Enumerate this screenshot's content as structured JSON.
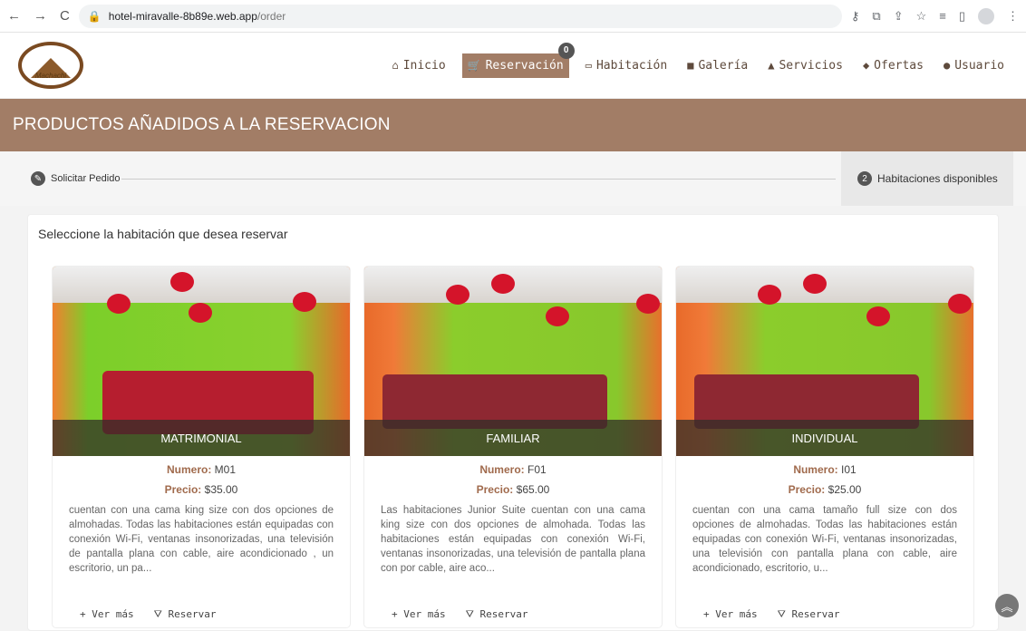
{
  "browser": {
    "url_host": "hotel-miravalle-8b89e.web.app",
    "url_path": "/order"
  },
  "logo": {
    "text": "Machachi"
  },
  "nav": {
    "items": [
      {
        "label": "Inicio",
        "icon": "home-icon"
      },
      {
        "label": "Reservación",
        "icon": "cart-icon",
        "badge": "0"
      },
      {
        "label": "Habitación",
        "icon": "bed-icon"
      },
      {
        "label": "Galería",
        "icon": "image-icon"
      },
      {
        "label": "Servicios",
        "icon": "eject-icon"
      },
      {
        "label": "Ofertas",
        "icon": "tag-icon"
      },
      {
        "label": "Usuario",
        "icon": "user-icon"
      }
    ]
  },
  "banner": {
    "title": "PRODUCTOS AÑADIDOS A LA RESERVACION"
  },
  "stepper": {
    "step1": "Solicitar Pedido",
    "step2_number": "2",
    "step2": "Habitaciones disponibles"
  },
  "main": {
    "heading": "Seleccione la habitación que desea reservar"
  },
  "rooms": [
    {
      "name": "MATRIMONIAL",
      "numero_label": "Numero:",
      "numero": "M01",
      "precio_label": "Precio:",
      "precio": "$35.00",
      "desc": "cuentan con una cama king size con dos opciones de almohadas. Todas las habitaciones están equipadas con conexión Wi-Fi, ventanas insonorizadas, una televisión de pantalla plana con cable, aire acondicionado , un escritorio, un pa..."
    },
    {
      "name": "FAMILIAR",
      "numero_label": "Numero:",
      "numero": "F01",
      "precio_label": "Precio:",
      "precio": "$65.00",
      "desc": "Las habitaciones Junior Suite cuentan con una cama king size con dos opciones de almohada. Todas las habitaciones están equipadas con conexión Wi-Fi, ventanas insonorizadas, una televisión de pantalla plana con por cable, aire aco..."
    },
    {
      "name": "INDIVIDUAL",
      "numero_label": "Numero:",
      "numero": "I01",
      "precio_label": "Precio:",
      "precio": "$25.00",
      "desc": "cuentan con una cama tamaño full size con dos opciones de almohadas. Todas las habitaciones están equipadas con conexión Wi-Fi, ventanas insonorizadas, una televisión con pantalla plana con cable, aire acondicionado, escritorio, u..."
    }
  ],
  "actions": {
    "ver_mas": "+ Ver más",
    "reservar": "Reservar"
  }
}
